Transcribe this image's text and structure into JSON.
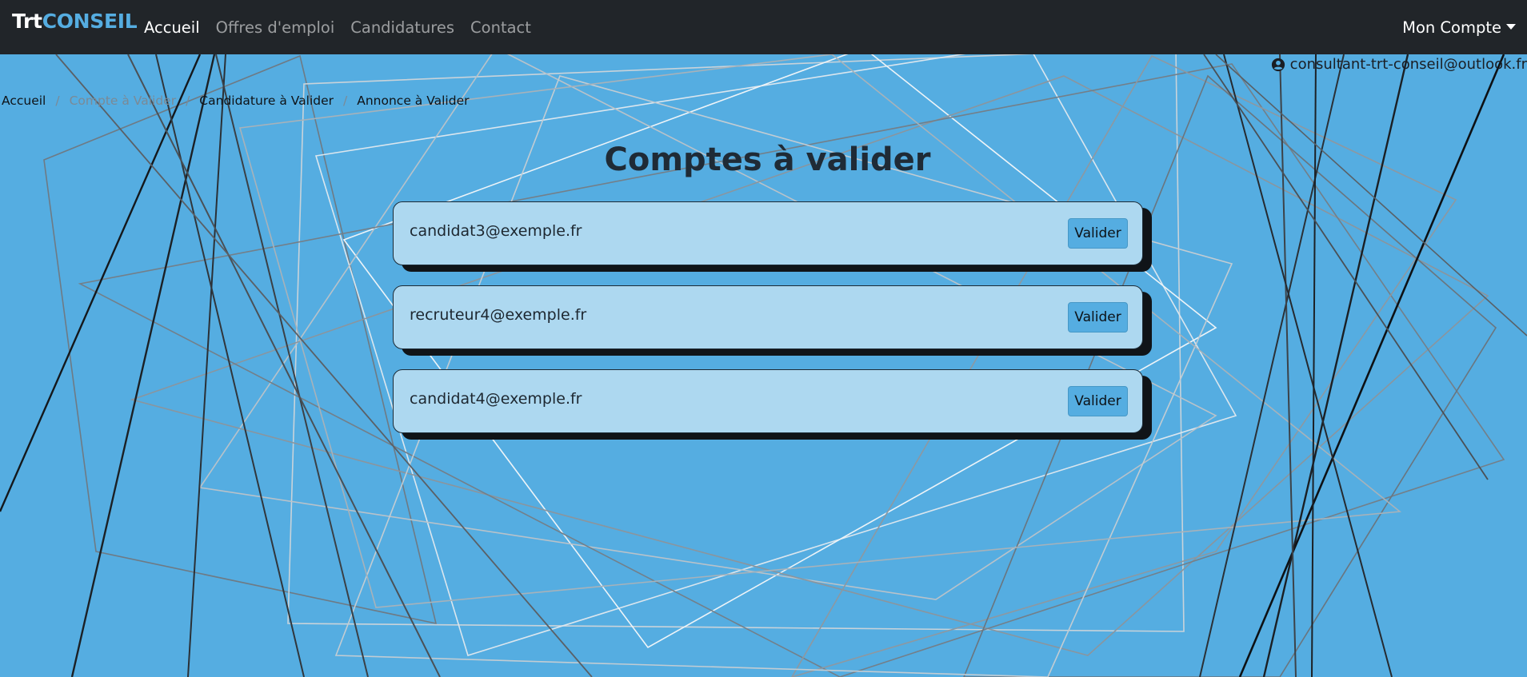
{
  "navbar": {
    "brand_part1": "Trt",
    "brand_part2": "CONSEIL",
    "links": [
      "Accueil",
      "Offres d'emploi",
      "Candidatures",
      "Contact"
    ],
    "account_label": "Mon Compte"
  },
  "user": {
    "icon": "user-circle-icon",
    "email": "consultant-trt-conseil@outlook.fr"
  },
  "breadcrumb": [
    "Accueil",
    "Compte à Valider",
    "Candidature à Valider",
    "Annonce à Valider"
  ],
  "breadcrumb_separator": "/",
  "page_title": "Comptes à valider",
  "accounts": [
    {
      "email": "candidat3@exemple.fr",
      "action": "Valider"
    },
    {
      "email": "recruteur4@exemple.fr",
      "action": "Valider"
    },
    {
      "email": "candidat4@exemple.fr",
      "action": "Valider"
    }
  ],
  "colors": {
    "background": "#55ade1",
    "navbar": "#212529",
    "brand_accent": "#55ade1",
    "card": "#add8f0",
    "button": "#55ade1"
  }
}
